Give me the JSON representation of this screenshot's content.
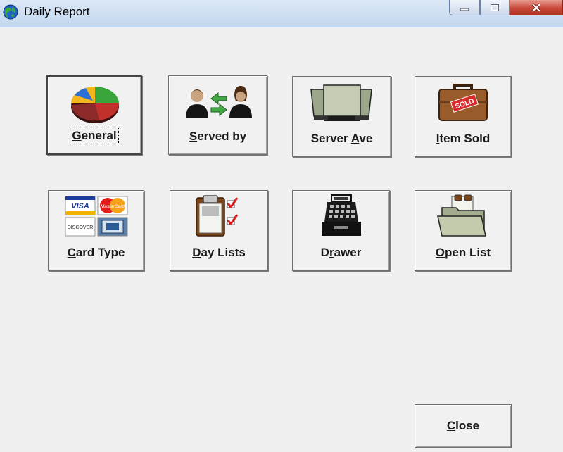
{
  "window": {
    "title": "Daily Report",
    "minimize_glyph": "▁",
    "maximize_glyph": "□",
    "close_glyph": "✕"
  },
  "tiles": [
    {
      "name": "general",
      "pre": "",
      "acc": "G",
      "post": "eneral",
      "icon": "pie-chart-icon"
    },
    {
      "name": "served-by",
      "pre": "",
      "acc": "S",
      "post": "erved by",
      "icon": "server-exchange-icon"
    },
    {
      "name": "server-ave",
      "pre": "Server ",
      "acc": "A",
      "post": "ve",
      "icon": "stack-trays-icon"
    },
    {
      "name": "item-sold",
      "pre": "",
      "acc": "I",
      "post": "tem Sold",
      "icon": "sold-suitcase-icon"
    },
    {
      "name": "card-type",
      "pre": "",
      "acc": "C",
      "post": "ard Type",
      "icon": "credit-cards-icon"
    },
    {
      "name": "day-lists",
      "pre": "",
      "acc": "D",
      "post": "ay Lists",
      "icon": "clipboard-checklist-icon"
    },
    {
      "name": "drawer",
      "pre": "D",
      "acc": "r",
      "post": "awer",
      "icon": "cash-register-icon"
    },
    {
      "name": "open-list",
      "pre": "",
      "acc": "O",
      "post": "pen List",
      "icon": "open-folder-icon"
    }
  ],
  "icon_text": {
    "sold": "SOLD",
    "visa": "VISA",
    "mastercard": "MasterCard",
    "discover": "DISCOVER"
  },
  "close_button": {
    "pre": "",
    "acc": "C",
    "post": "lose"
  },
  "colors": {
    "close_red": "#c9483a",
    "title_bg": "#c3d7ee"
  }
}
